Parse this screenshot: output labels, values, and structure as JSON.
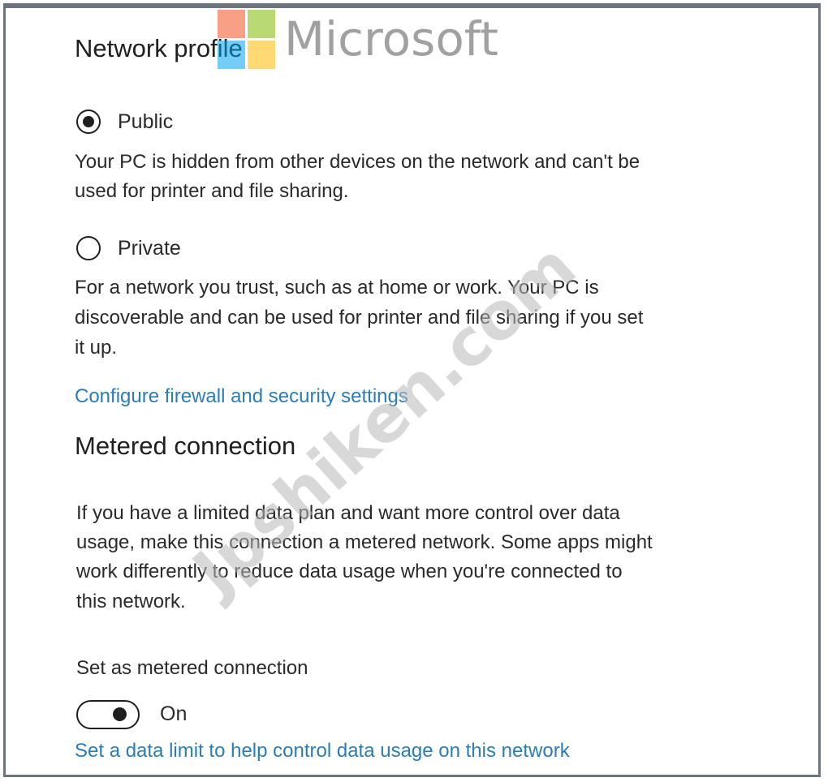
{
  "network_profile": {
    "heading": "Network profile",
    "public": {
      "label": "Public",
      "selected": true,
      "desc_line1": "Your PC is hidden from other devices on the network and can't be",
      "desc_line2": "used for printer and file sharing."
    },
    "private": {
      "label": "Private",
      "selected": false,
      "desc_line1": "For a network you trust, such as at home or work. Your PC is",
      "desc_line2": "discoverable and can be used for printer and file sharing if you set",
      "desc_line3": "it up."
    },
    "firewall_link": "Configure firewall and security settings"
  },
  "metered": {
    "heading": "Metered connection",
    "desc_line1": "If you have a limited data plan and want more control over data",
    "desc_line2": "usage, make this connection a metered network. Some apps might",
    "desc_line3": "work differently to reduce data usage when you're connected to",
    "desc_line4": "this network.",
    "set_label": "Set as metered connection",
    "toggle_state": "On",
    "toggle_on": true,
    "data_limit_link": "Set a data limit to help control data usage on this network"
  },
  "overlay": {
    "brand_word": "Microsoft",
    "watermark": "Jpshiken.com"
  },
  "colors": {
    "link": "#2b7db8",
    "frame": "#6e747c",
    "logo": [
      "#f25022",
      "#7fba00",
      "#00a4ef",
      "#ffb900"
    ]
  }
}
